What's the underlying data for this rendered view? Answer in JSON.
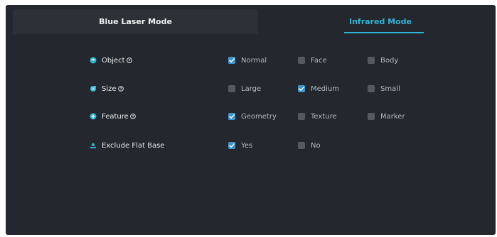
{
  "tabs": {
    "blue_laser": "Blue Laser Mode",
    "infrared": "Infrared Mode"
  },
  "rows": [
    {
      "label": "Object",
      "icon": "object-icon",
      "options": [
        {
          "label": "Normal",
          "checked": true
        },
        {
          "label": "Face",
          "checked": false
        },
        {
          "label": "Body",
          "checked": false
        }
      ]
    },
    {
      "label": "Size",
      "icon": "size-icon",
      "options": [
        {
          "label": "Large",
          "checked": false
        },
        {
          "label": "Medium",
          "checked": true
        },
        {
          "label": "Small",
          "checked": false
        }
      ]
    },
    {
      "label": "Feature",
      "icon": "feature-icon",
      "options": [
        {
          "label": "Geometry",
          "checked": true
        },
        {
          "label": "Texture",
          "checked": false
        },
        {
          "label": "Marker",
          "checked": false
        }
      ]
    },
    {
      "label": "Exclude Flat Base",
      "icon": "flat-base-icon",
      "options": [
        {
          "label": "Yes",
          "checked": true
        },
        {
          "label": "No",
          "checked": false
        }
      ]
    }
  ],
  "colors": {
    "panel": "#24272d",
    "tab_inactive": "#2d3037",
    "accent": "#2fb3d6",
    "checkbox_checked": "#3f95cb",
    "checkbox_unchecked": "#555961"
  }
}
